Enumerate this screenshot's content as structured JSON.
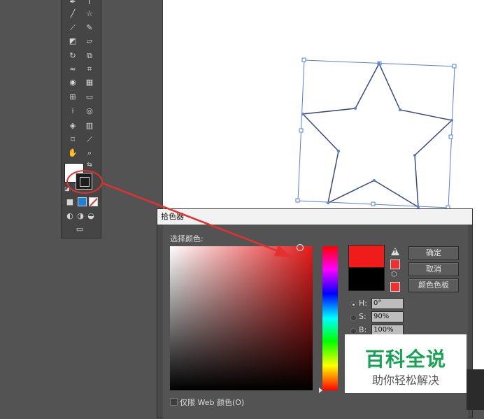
{
  "dialog": {
    "title": "拾色器",
    "select_label": "选择颜色:",
    "buttons": {
      "ok": "确定",
      "cancel": "取消",
      "swatches": "颜色色板"
    },
    "fields": [
      {
        "label": "H:",
        "value": "0°",
        "selected": true
      },
      {
        "label": "S:",
        "value": "90%",
        "selected": false
      },
      {
        "label": "B:",
        "value": "100%",
        "selected": false
      }
    ],
    "web_only_label": "仅限 Web 颜色(O)",
    "colors": {
      "new": "#f01c1c",
      "current": "#000000",
      "hue": "#ff0000"
    }
  },
  "toolbar": {
    "icons": [
      "pen-icon",
      "type-icon",
      "line-icon",
      "star-icon",
      "brush-icon",
      "pencil-icon",
      "blob-brush-icon",
      "eraser-icon",
      "rotate-icon",
      "scale-icon",
      "warp-icon",
      "free-transform-icon",
      "shape-builder-icon",
      "perspective-icon",
      "mesh-icon",
      "gradient-icon",
      "eyedropper-icon",
      "blend-icon",
      "symbol-sprayer-icon",
      "column-graph-icon",
      "artboard-icon",
      "slice-icon",
      "hand-icon",
      "zoom-icon"
    ],
    "fill_color": "#ffffff",
    "stroke_color": "#1e1e1e"
  },
  "watermark": {
    "title": "百科全说",
    "subtitle": "助你轻松解决"
  },
  "annotation_color": "#e53030",
  "shape_color": "#3a4a7a",
  "selection_color": "#5b7fd6"
}
